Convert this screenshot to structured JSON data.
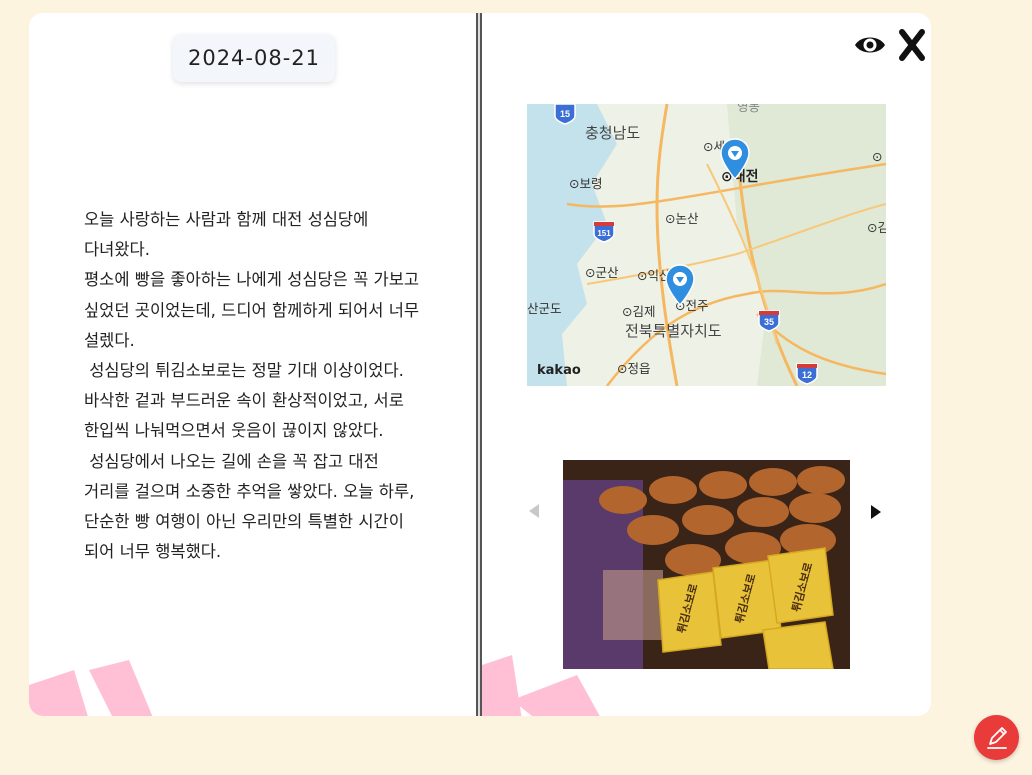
{
  "diary": {
    "date": "2024-08-21",
    "text": "오늘 사랑하는 사람과 함께 대전 성심당에 다녀왔다.\n평소에 빵을 좋아하는 나에게 성심당은 꼭 가보고 싶었던 곳이었는데, 드디어 함께하게 되어서 너무 설렜다.\n 성심당의 튀김소보로는 정말 기대 이상이었다. 바삭한 겉과 부드러운 속이 환상적이었고, 서로 한입씩 나눠먹으면서 웃음이 끊이지 않았다.\n 성심당에서 나오는 길에 손을 꼭 잡고 대전 거리를 걸으며 소중한 추억을 쌓았다. 오늘 하루, 단순한 빵 여행이 아닌 우리만의 특별한 시간이 되어 너무 행복했다."
  },
  "toolbar": {
    "view_icon": "eye-icon",
    "close_icon": "close-icon"
  },
  "map": {
    "logo": "kakao",
    "labels": {
      "chungnam": "충청남도",
      "sejong": "세종",
      "daejeon": "대전",
      "boryeong": "보령",
      "nonsan": "논산",
      "gim_right": "김",
      "gunsan": "군산",
      "iksan": "익산",
      "gunsangundo": "산군도",
      "gimje": "김제",
      "jeonju": "전주",
      "jeonbuk": "전북특별자치도",
      "jeongeup": "정읍",
      "top_partial": "영동"
    },
    "shields": {
      "r15": "15",
      "r151": "151",
      "r35": "35",
      "r12": "12"
    },
    "markers": [
      "대전",
      "전주"
    ]
  },
  "gallery": {
    "prev_icon": "triangle-left-icon",
    "next_icon": "triangle-right-icon",
    "photo_label": "튀김소보로"
  },
  "fab": {
    "icon": "pencil-icon"
  },
  "colors": {
    "background": "#fdf4df",
    "accent_pink": "#ffc0d6",
    "fab": "#ea3b3b",
    "map_water": "#c4e2ec",
    "marker": "#2f8ee0"
  }
}
